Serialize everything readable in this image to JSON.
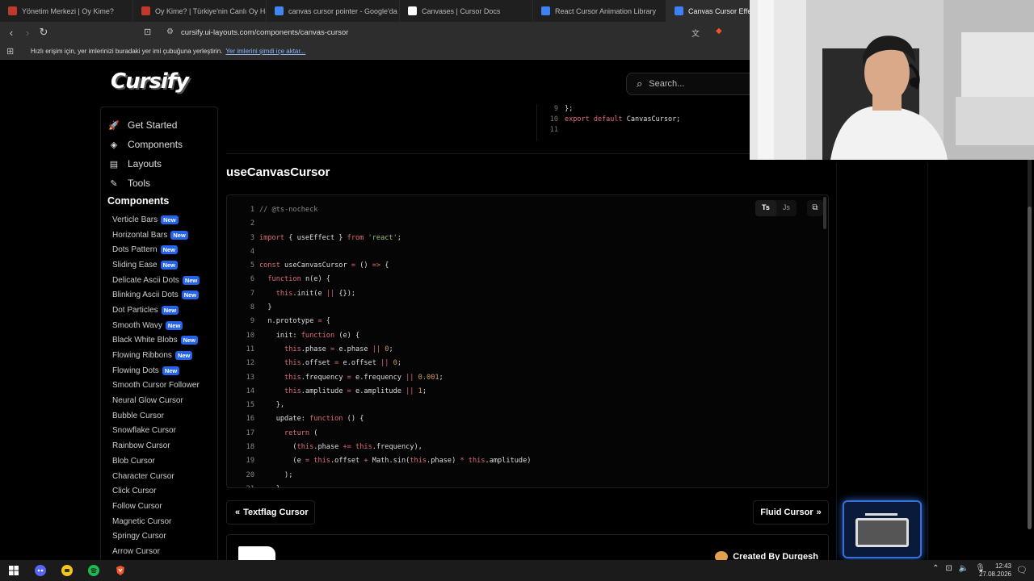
{
  "browser": {
    "tabs": [
      {
        "title": "Yönetim Merkezi | Oy Kime?",
        "color": "#c0392b",
        "active": false
      },
      {
        "title": "Oy Kime? | Türkiye'nin Canlı Oy Harita",
        "color": "#c0392b",
        "active": false
      },
      {
        "title": "canvas cursor pointer - Google'da Ar",
        "color": "#4285f4",
        "active": false
      },
      {
        "title": "Canvases | Cursor Docs",
        "color": "#ffffff",
        "active": false
      },
      {
        "title": "React Cursor Animation Library",
        "color": "#3b82f6",
        "active": false
      },
      {
        "title": "Canvas Cursor Effect - C",
        "color": "#3b82f6",
        "active": true
      }
    ],
    "url": "cursify.ui-layouts.com/components/canvas-cursor",
    "bookmarks_bar": {
      "text": "Hızlı erişim için, yer imlerinizi buradaki yer imi çubuğuna yerleştirin.",
      "link": "Yer imlerini şimdi içe aktar..."
    }
  },
  "site": {
    "logo": "Cursify",
    "search_placeholder": "Search...",
    "nav": [
      {
        "label": "Get Started",
        "icon": "rocket-icon",
        "glyph": "🚀"
      },
      {
        "label": "Components",
        "icon": "components-icon",
        "glyph": "◈"
      },
      {
        "label": "Layouts",
        "icon": "layouts-icon",
        "glyph": "▤"
      },
      {
        "label": "Tools",
        "icon": "tools-icon",
        "glyph": "✎"
      }
    ],
    "components_heading": "Components",
    "components": [
      {
        "label": "Verticle Bars",
        "new": true
      },
      {
        "label": "Horizontal Bars",
        "new": true
      },
      {
        "label": "Dots Pattern",
        "new": true
      },
      {
        "label": "Sliding Ease",
        "new": true
      },
      {
        "label": "Delicate Ascii Dots",
        "new": true
      },
      {
        "label": "Blinking Ascii Dots",
        "new": true
      },
      {
        "label": "Dot Particles",
        "new": true
      },
      {
        "label": "Smooth Wavy",
        "new": true
      },
      {
        "label": "Black White Blobs",
        "new": true
      },
      {
        "label": "Flowing Ribbons",
        "new": true
      },
      {
        "label": "Flowing Dots",
        "new": true
      },
      {
        "label": "Smooth Cursor Follower",
        "new": false
      },
      {
        "label": "Neural Glow Cursor",
        "new": false
      },
      {
        "label": "Bubble Cursor",
        "new": false
      },
      {
        "label": "Snowflake Cursor",
        "new": false
      },
      {
        "label": "Rainbow Cursor",
        "new": false
      },
      {
        "label": "Blob Cursor",
        "new": false
      },
      {
        "label": "Character Cursor",
        "new": false
      },
      {
        "label": "Click Cursor",
        "new": false
      },
      {
        "label": "Follow Cursor",
        "new": false
      },
      {
        "label": "Magnetic Cursor",
        "new": false
      },
      {
        "label": "Springy Cursor",
        "new": false
      },
      {
        "label": "Arrow Cursor",
        "new": false
      }
    ],
    "badge_new": "New",
    "top_code": [
      {
        "n": "9",
        "html": "};"
      },
      {
        "n": "10",
        "html": "<span class=\"kw\">export default</span> CanvasCursor;"
      },
      {
        "n": "11",
        "html": ""
      }
    ],
    "section_title": "useCanvasCursor",
    "lang": {
      "ts": "Ts",
      "js": "Js"
    },
    "code": [
      {
        "n": "1",
        "html": "<span class=\"cmt\">// @ts-nocheck</span>"
      },
      {
        "n": "2",
        "html": ""
      },
      {
        "n": "3",
        "html": "<span class=\"kw\">import</span> { useEffect } <span class=\"kw\">from</span> <span class=\"str\">'react'</span>;"
      },
      {
        "n": "4",
        "html": ""
      },
      {
        "n": "5",
        "html": "<span class=\"kw\">const</span> useCanvasCursor <span class=\"kw\">=</span> () <span class=\"kw\">=&gt;</span> {"
      },
      {
        "n": "6",
        "html": "  <span class=\"kw\">function</span> n(e) {"
      },
      {
        "n": "7",
        "html": "    <span class=\"kw\">this</span>.init(e <span class=\"kw\">||</span> {});"
      },
      {
        "n": "8",
        "html": "  }"
      },
      {
        "n": "9",
        "html": "  n.prototype <span class=\"kw\">=</span> {"
      },
      {
        "n": "10",
        "html": "    init: <span class=\"kw\">function</span> (e) {"
      },
      {
        "n": "11",
        "html": "      <span class=\"kw\">this</span>.phase <span class=\"kw\">=</span> e.phase <span class=\"kw\">||</span> <span class=\"num\">0</span>;"
      },
      {
        "n": "12",
        "html": "      <span class=\"kw\">this</span>.offset <span class=\"kw\">=</span> e.offset <span class=\"kw\">||</span> <span class=\"num\">0</span>;"
      },
      {
        "n": "13",
        "html": "      <span class=\"kw\">this</span>.frequency <span class=\"kw\">=</span> e.frequency <span class=\"kw\">||</span> <span class=\"num\">0.001</span>;"
      },
      {
        "n": "14",
        "html": "      <span class=\"kw\">this</span>.amplitude <span class=\"kw\">=</span> e.amplitude <span class=\"kw\">||</span> <span class=\"num\">1</span>;"
      },
      {
        "n": "15",
        "html": "    },"
      },
      {
        "n": "16",
        "html": "    update: <span class=\"kw\">function</span> () {"
      },
      {
        "n": "17",
        "html": "      <span class=\"kw\">return</span> ("
      },
      {
        "n": "18",
        "html": "        (<span class=\"kw\">this</span>.phase <span class=\"kw\">+=</span> <span class=\"kw\">this</span>.frequency),"
      },
      {
        "n": "19",
        "html": "        (e <span class=\"kw\">=</span> <span class=\"kw\">this</span>.offset <span class=\"kw\">+</span> Math.sin(<span class=\"kw\">this</span>.phase) <span class=\"kw\">*</span> <span class=\"kw\">this</span>.amplitude)"
      },
      {
        "n": "20",
        "html": "      );"
      },
      {
        "n": "21",
        "html": "    },"
      }
    ],
    "prev_label": "Textflag Cursor",
    "next_label": "Fluid Cursor",
    "footer_credit": "Created By  Durgesh"
  },
  "taskbar": {
    "time": "12:43",
    "date": "27.08.2026"
  }
}
